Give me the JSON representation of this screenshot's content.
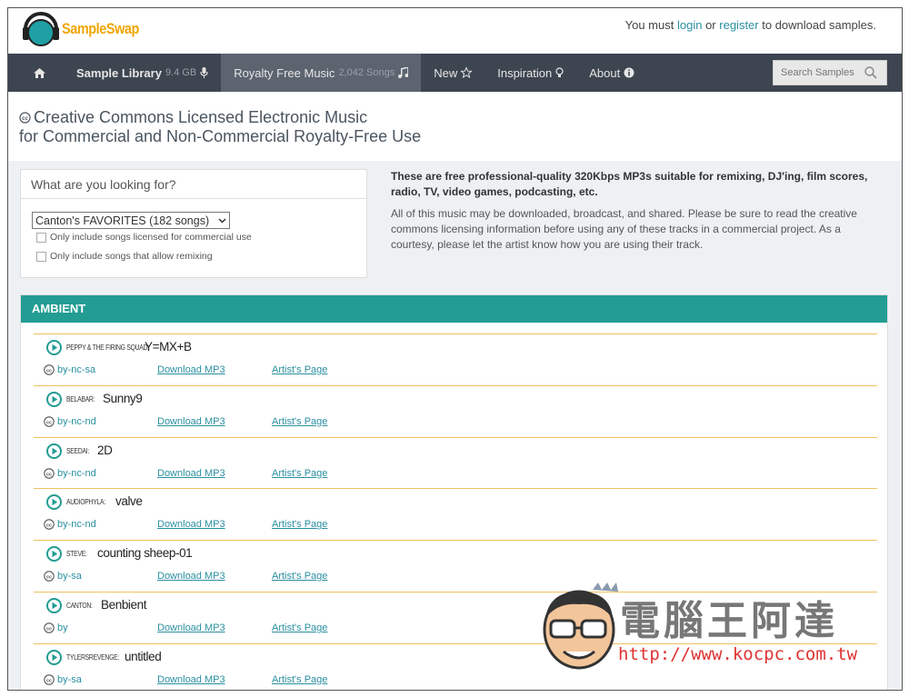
{
  "header": {
    "logo_text": "SampleSwap",
    "account_prefix": "You must",
    "login": "login",
    "or": "or",
    "register": "register",
    "account_suffix": "to download samples."
  },
  "nav": {
    "sample_library": "Sample Library",
    "sample_library_size": "9.4 GB",
    "royalty_free": "Royalty Free Music",
    "royalty_free_count": "2,042 Songs",
    "new": "New",
    "inspiration": "Inspiration",
    "about": "About",
    "search_placeholder": "Search Samples"
  },
  "title": {
    "line1": "Creative Commons Licensed Electronic Music",
    "line2": "for Commercial and Non-Commercial Royalty-Free Use"
  },
  "filter": {
    "question": "What are you looking for?",
    "selected": "Canton's FAVORITES (182 songs)",
    "opt_commercial": "Only include songs licensed for commercial use",
    "opt_remix": "Only include songs that allow remixing"
  },
  "intro": {
    "lead": "These are free professional-quality 320Kbps MP3s suitable for remixing, DJ'ing, film scores, radio, TV, video games, podcasting, etc.",
    "body": "All of this music may be downloaded, broadcast, and shared. Please be sure to read the creative commons licensing information before using any of these tracks in a commercial project. As a courtesy, please let the artist know how you are using their track."
  },
  "section": {
    "title": "AMBIENT"
  },
  "tracks": [
    {
      "artist": "PEPPY & THE FIRING SQUAD:",
      "song": "Y=MX+B",
      "license": "by-nc-sa",
      "download": "Download MP3",
      "artist_page": "Artist's Page"
    },
    {
      "artist": "BELABAR:",
      "song": "Sunny9",
      "license": "by-nc-nd",
      "download": "Download MP3",
      "artist_page": "Artist's Page"
    },
    {
      "artist": "SEEDAI:",
      "song": "2D",
      "license": "by-nc-nd",
      "download": "Download MP3",
      "artist_page": "Artist's Page"
    },
    {
      "artist": "AUDIOPHYLA:",
      "song": "valve",
      "license": "by-nc-nd",
      "download": "Download MP3",
      "artist_page": "Artist's Page"
    },
    {
      "artist": "STEVE:",
      "song": "counting sheep-01",
      "license": "by-sa",
      "download": "Download MP3",
      "artist_page": "Artist's Page"
    },
    {
      "artist": "CANTON:",
      "song": "Benbient",
      "license": "by",
      "download": "Download MP3",
      "artist_page": "Artist's Page"
    },
    {
      "artist": "TYLERSREVENGE:",
      "song": "untitled",
      "license": "by-sa",
      "download": "Download MP3",
      "artist_page": "Artist's Page"
    }
  ],
  "watermark": {
    "title": "電腦王阿達",
    "url": "http://www.kocpc.com.tw"
  },
  "colors": {
    "accent": "#239c93",
    "nav_bg": "#3d4550",
    "link": "#2a8fa0",
    "logo": "#f0a500",
    "divider": "#f0c060"
  }
}
